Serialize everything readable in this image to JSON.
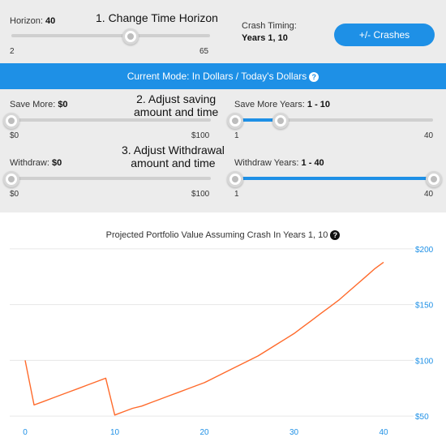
{
  "controls": {
    "horizon": {
      "label": "Horizon:",
      "value": "40",
      "min_label": "2",
      "max_label": "65",
      "min": 2,
      "max": 65,
      "current": 40
    },
    "annotation_1": "1. Change Time Horizon",
    "crash_timing": {
      "label": "Crash Timing:",
      "value": "Years 1, 10"
    },
    "crashes_button": "+/- Crashes",
    "mode_bar": {
      "text": "Current Mode: In Dollars / Today's Dollars",
      "help_icon": "?"
    },
    "save_more": {
      "label": "Save More:",
      "value": "$0",
      "min_label": "$0",
      "max_label": "$100",
      "min": 0,
      "max": 100,
      "current": 0
    },
    "annotation_2": [
      "2. Adjust saving",
      "amount and time"
    ],
    "save_more_years": {
      "label": "Save More Years:",
      "value": "1 - 10",
      "min_label": "1",
      "max_label": "40",
      "min": 1,
      "max": 40,
      "low": 1,
      "high": 10
    },
    "annotation_3": [
      "3. Adjust Withdrawal",
      "amount and time"
    ],
    "withdraw": {
      "label": "Withdraw:",
      "value": "$0",
      "min_label": "$0",
      "max_label": "$100",
      "min": 0,
      "max": 100,
      "current": 0
    },
    "withdraw_years": {
      "label": "Withdraw Years:",
      "value": "1 - 40",
      "min_label": "1",
      "max_label": "40",
      "min": 1,
      "max": 40,
      "low": 1,
      "high": 40
    }
  },
  "chart_data": {
    "type": "line",
    "title": "Projected Portfolio Value Assuming Crash In Years 1, 10",
    "help_icon": "?",
    "xlabel": "",
    "ylabel": "",
    "xlim": [
      0,
      40
    ],
    "ylim": [
      45,
      205
    ],
    "x_ticks": [
      0,
      10,
      20,
      30,
      40
    ],
    "y_ticks": [
      50,
      100,
      150,
      200
    ],
    "y_tick_labels": [
      "$50",
      "$100",
      "$150",
      "$200"
    ],
    "grid": true,
    "line_color": "#ff6a2b",
    "tick_color": "#1e90e6",
    "series": [
      {
        "x": [
          0,
          1,
          2,
          3,
          4,
          5,
          6,
          7,
          8,
          9,
          9,
          10,
          11,
          12,
          13,
          14,
          15,
          16,
          17,
          18,
          19,
          20,
          21,
          22,
          23,
          24,
          25,
          26,
          27,
          28,
          29,
          30,
          31,
          32,
          33,
          34,
          35,
          36,
          37,
          38,
          39,
          40
        ],
        "y": [
          100,
          60,
          63,
          66,
          69,
          72,
          75,
          78,
          81,
          84,
          84,
          51,
          54,
          57,
          59,
          62,
          65,
          68,
          71,
          74,
          77,
          80,
          84,
          88,
          92,
          96,
          100,
          104,
          109,
          114,
          119,
          124,
          130,
          136,
          142,
          148,
          154,
          161,
          168,
          175,
          182,
          188
        ]
      }
    ]
  }
}
